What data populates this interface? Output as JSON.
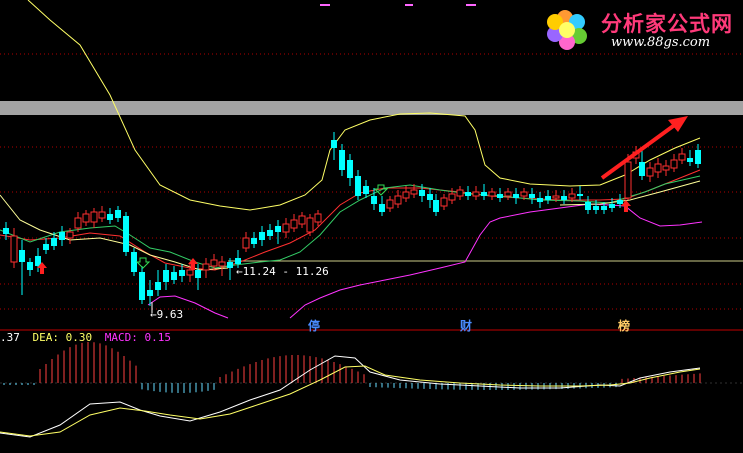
{
  "logo": {
    "title": "分析家公式网",
    "url": "www.88gs.com"
  },
  "annotations": {
    "low_price": "9.63",
    "range_label": "11.24 - 11.26"
  },
  "markers": [
    {
      "label": "停"
    },
    {
      "label": "财"
    },
    {
      "label": "榜"
    }
  ],
  "indicator": {
    "dif_label": ".37",
    "dea_label": "DEA: 0.30",
    "macd_label": "MACD: 0.15"
  },
  "colors": {
    "background": "#000000",
    "up_candle": "#ff3030",
    "down_candle": "#00ffff",
    "upper_band": "#ffff66",
    "lower_band": "#ff33ff",
    "mid_band": "#ff3030",
    "ma_line": "#33cc66",
    "grid": "#cc0000",
    "banner": "#a0a0a0",
    "arrow": "#ff2020"
  }
}
